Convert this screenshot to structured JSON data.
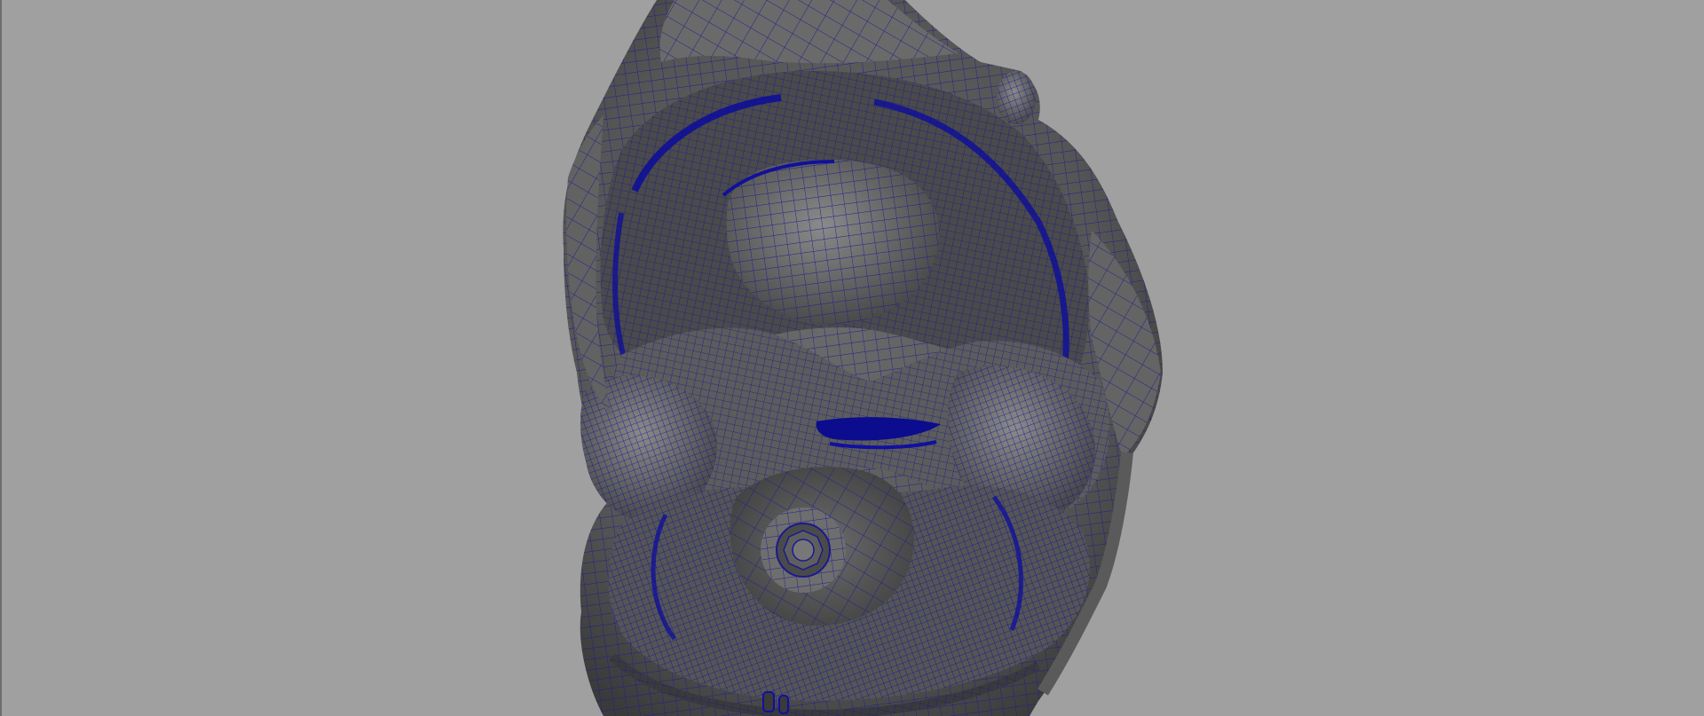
{
  "viewport": {
    "background_color": "#a0a0a0",
    "panel_label": "3d-viewport-perspective"
  },
  "model": {
    "display_mode": "wireframe-on-shaded",
    "shade_color": "#5e5e5e",
    "shade_dark_color": "#3c3c3c",
    "shade_light_color": "#777777",
    "wire_color": "#1a1a8c",
    "wire_dense_color": "#0a0a9a"
  }
}
